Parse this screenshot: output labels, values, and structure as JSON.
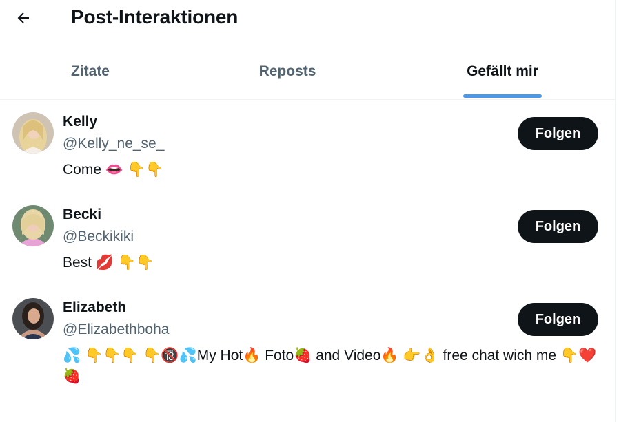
{
  "header": {
    "title": "Post-Interaktionen",
    "back_icon": "arrow-left-icon"
  },
  "tabs": [
    {
      "label": "Zitate",
      "active": false
    },
    {
      "label": "Reposts",
      "active": false
    },
    {
      "label": "Gefällt mir",
      "active": true
    }
  ],
  "colors": {
    "accent": "#4a99e9",
    "text_primary": "#0f1419",
    "text_secondary": "#536471",
    "button_bg": "#0f1419",
    "divider": "#eff3f4"
  },
  "users": [
    {
      "name": "Kelly",
      "handle": "@Kelly_ne_se_",
      "bio": "Come 👄 👇👇",
      "follow_label": "Folgen"
    },
    {
      "name": "Becki",
      "handle": "@Beckikiki",
      "bio": "Best 💋 👇👇",
      "follow_label": "Folgen"
    },
    {
      "name": "Elizabeth",
      "handle": "@Elizabethboha",
      "bio": "💦 👇👇👇 👇🔞💦My Hot🔥 Foto🍓 and Video🔥 👉👌 free chat wich me 👇❤️🍓",
      "follow_label": "Folgen"
    }
  ]
}
